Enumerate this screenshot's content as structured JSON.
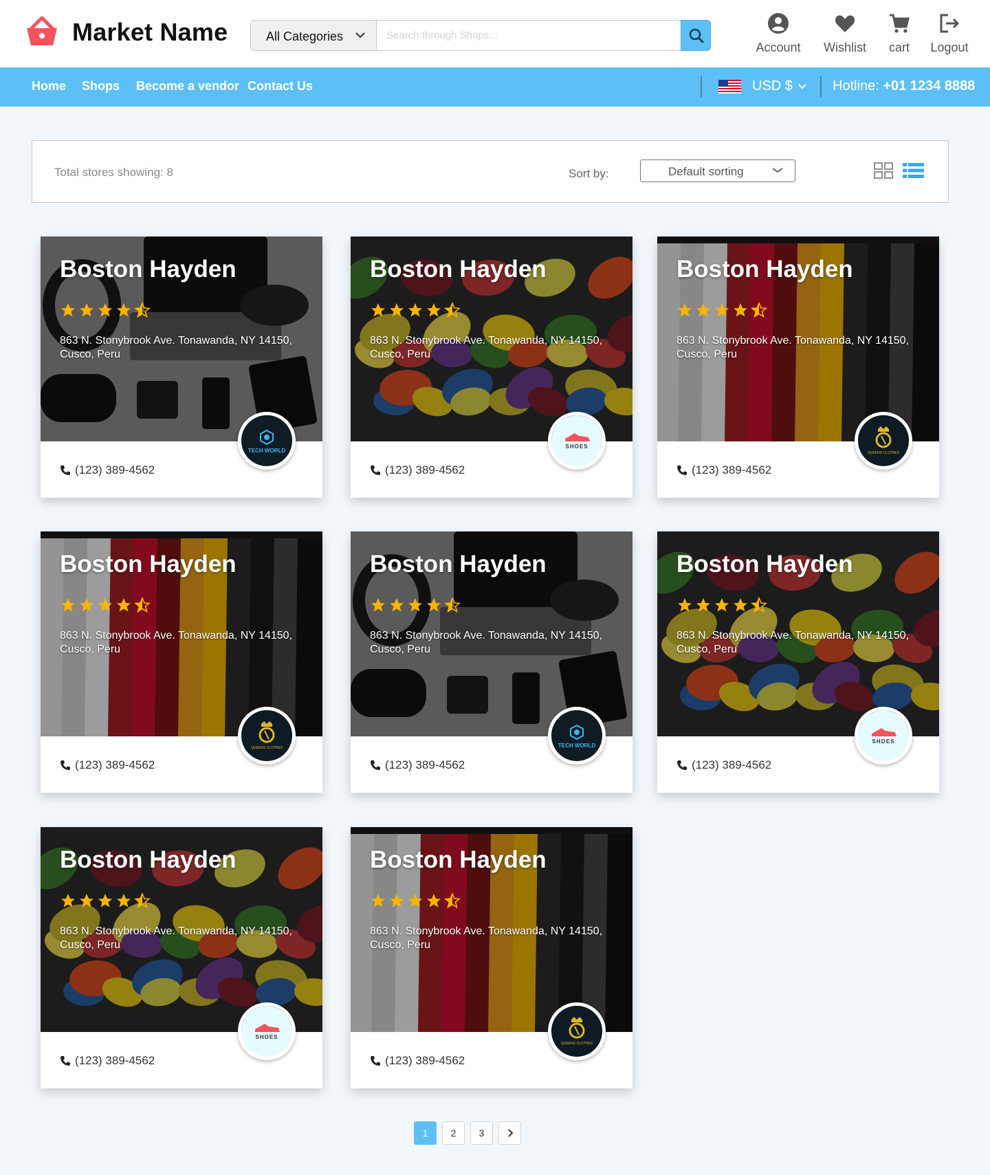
{
  "brand": {
    "name": "Market Name"
  },
  "search": {
    "category": "All Categories",
    "placeholder": "Search through Shops..."
  },
  "header_actions": [
    {
      "label": "Account",
      "icon": "account-icon"
    },
    {
      "label": "Wishlist",
      "icon": "heart-icon"
    },
    {
      "label": "cart",
      "icon": "cart-icon"
    },
    {
      "label": "Logout",
      "icon": "logout-icon"
    }
  ],
  "nav": {
    "links": [
      "Home",
      "Shops",
      "Become a vendor",
      "Contact Us"
    ],
    "currency": "USD $",
    "hotline_label": "Hotline:",
    "hotline_number": "+01 1234 8888"
  },
  "toolbar": {
    "total": "Total stores showing: 8",
    "sort_label": "Sort by:",
    "sort_value": "Default sorting"
  },
  "stores": [
    {
      "name": "Boston Hayden",
      "address": "863 N. Stonybrook Ave. Tonawanda, NY 14150, Cusco, Peru",
      "phone": "(123) 389-4562",
      "rating": 4.5,
      "image": "electronics",
      "logo": "tech-world"
    },
    {
      "name": "Boston Hayden",
      "address": "863 N. Stonybrook Ave. Tonawanda, NY 14150, Cusco, Peru",
      "phone": "(123) 389-4562",
      "rating": 4.5,
      "image": "shoes",
      "logo": "shoes"
    },
    {
      "name": "Boston Hayden",
      "address": "863 N. Stonybrook Ave. Tonawanda, NY 14150, Cusco, Peru",
      "phone": "(123) 389-4562",
      "rating": 4.5,
      "image": "clothes",
      "logo": "queens-clothes"
    },
    {
      "name": "Boston Hayden",
      "address": "863 N. Stonybrook Ave. Tonawanda, NY 14150, Cusco, Peru",
      "phone": "(123) 389-4562",
      "rating": 4.5,
      "image": "clothes",
      "logo": "queens-clothes"
    },
    {
      "name": "Boston Hayden",
      "address": "863 N. Stonybrook Ave. Tonawanda, NY 14150, Cusco, Peru",
      "phone": "(123) 389-4562",
      "rating": 4.5,
      "image": "electronics",
      "logo": "tech-world"
    },
    {
      "name": "Boston Hayden",
      "address": "863 N. Stonybrook Ave. Tonawanda, NY 14150, Cusco, Peru",
      "phone": "(123) 389-4562",
      "rating": 4.5,
      "image": "shoes",
      "logo": "shoes"
    },
    {
      "name": "Boston Hayden",
      "address": "863 N. Stonybrook Ave. Tonawanda, NY 14150, Cusco, Peru",
      "phone": "(123) 389-4562",
      "rating": 4.5,
      "image": "shoes",
      "logo": "shoes"
    },
    {
      "name": "Boston Hayden",
      "address": "863 N. Stonybrook Ave. Tonawanda, NY 14150, Cusco, Peru",
      "phone": "(123) 389-4562",
      "rating": 4.5,
      "image": "clothes",
      "logo": "queens-clothes"
    }
  ],
  "logos": {
    "tech-world": "TECH WORLD",
    "shoes": "SHOES",
    "queens-clothes": "QUEENS CLOTHES"
  },
  "pagination": {
    "pages": [
      "1",
      "2",
      "3"
    ],
    "current": "1"
  },
  "colors": {
    "accent": "#5cc0f6",
    "star": "#f7b500",
    "logo_red": "#f2545b"
  }
}
